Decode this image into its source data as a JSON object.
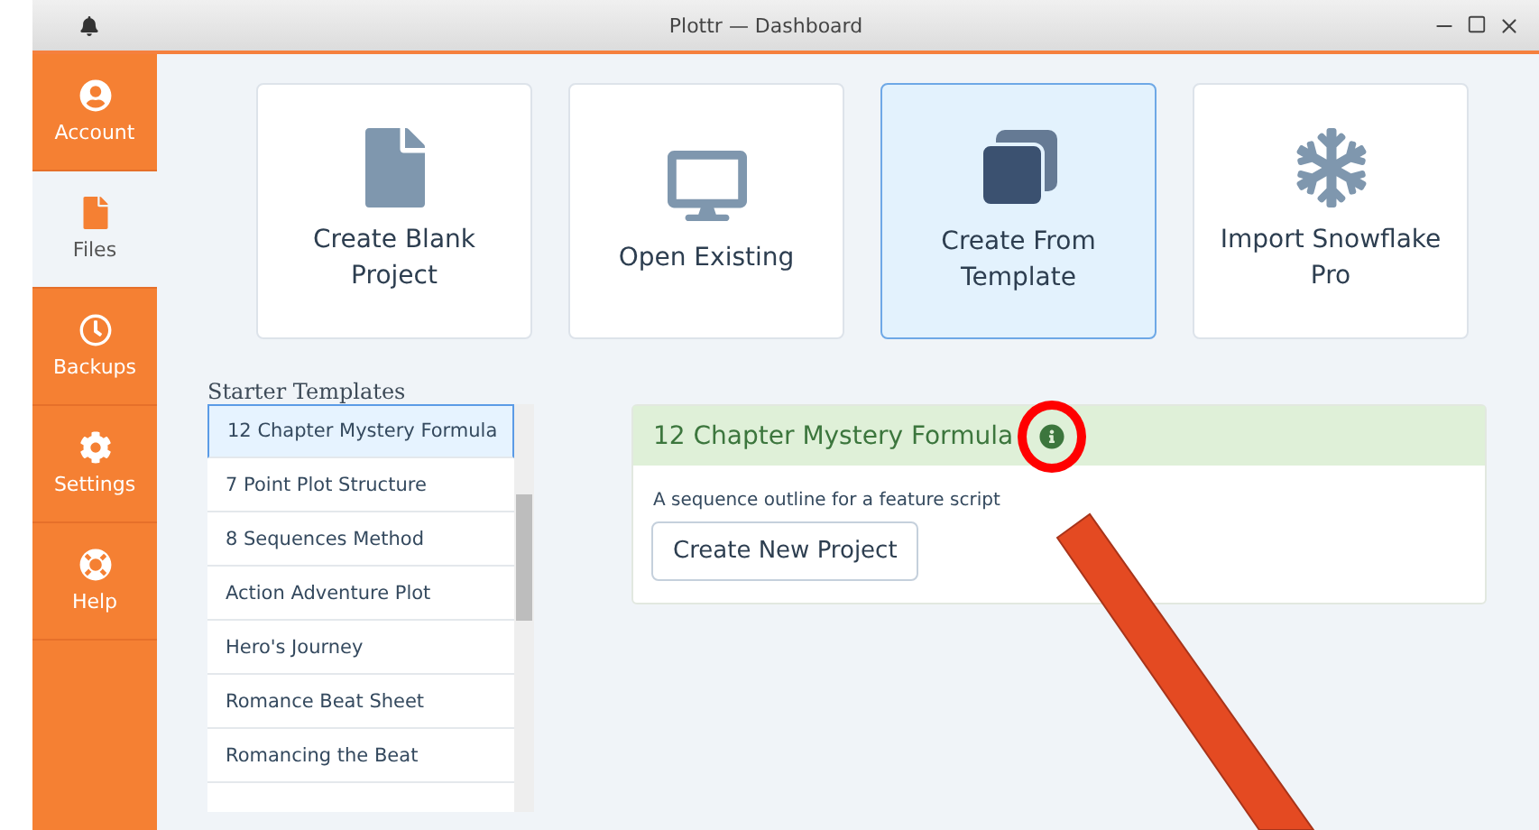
{
  "window": {
    "title": "Plottr — Dashboard"
  },
  "sidebar": {
    "items": [
      {
        "label": "Account",
        "kind": "user",
        "selected": false
      },
      {
        "label": "Files",
        "kind": "file",
        "selected": true
      },
      {
        "label": "Backups",
        "kind": "clock",
        "selected": false
      },
      {
        "label": "Settings",
        "kind": "gear",
        "selected": false
      },
      {
        "label": "Help",
        "kind": "lifebuoy",
        "selected": false
      }
    ]
  },
  "actions": [
    {
      "label": "Create Blank Project",
      "kind": "file",
      "selected": false
    },
    {
      "label": "Open Existing",
      "kind": "monitor",
      "selected": false
    },
    {
      "label": "Create From Template",
      "kind": "copies",
      "selected": true
    },
    {
      "label": "Import Snowflake Pro",
      "kind": "snowflake",
      "selected": false
    }
  ],
  "templates": {
    "heading": "Starter Templates",
    "items": [
      {
        "label": "12 Chapter Mystery Formula",
        "selected": true
      },
      {
        "label": "7 Point Plot Structure",
        "selected": false
      },
      {
        "label": "8 Sequences Method",
        "selected": false
      },
      {
        "label": "Action Adventure Plot",
        "selected": false
      },
      {
        "label": "Hero's Journey",
        "selected": false
      },
      {
        "label": "Romance Beat Sheet",
        "selected": false
      },
      {
        "label": "Romancing the Beat",
        "selected": false
      }
    ]
  },
  "detail": {
    "title": "12 Chapter Mystery Formula",
    "description": "A sequence outline for a feature script",
    "button": "Create New Project"
  }
}
